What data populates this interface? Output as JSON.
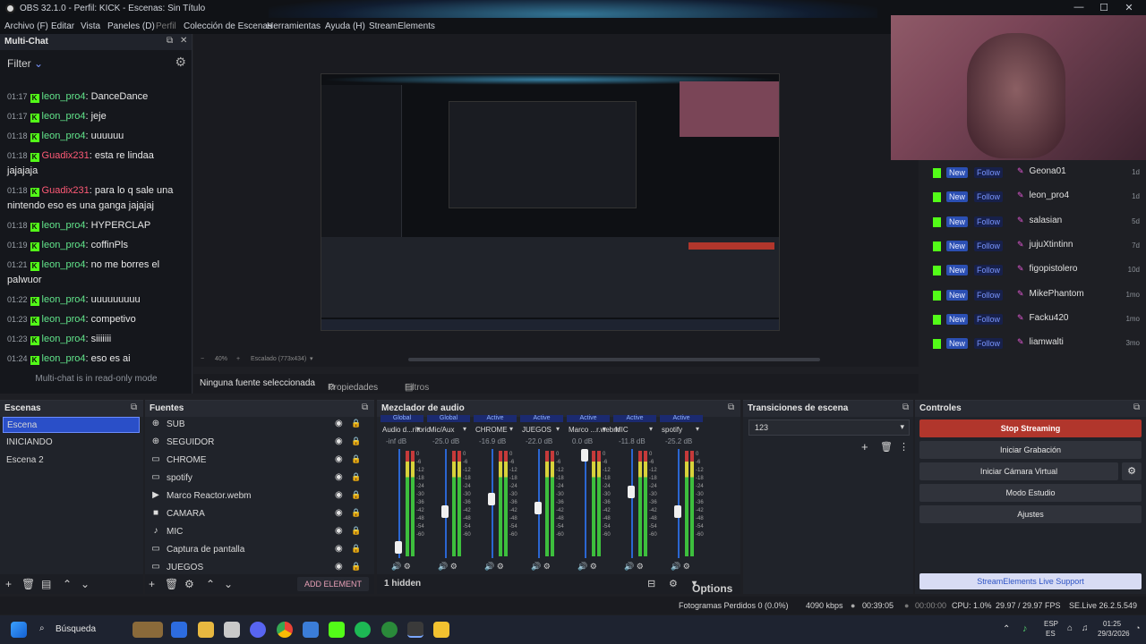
{
  "window": {
    "title": "OBS 32.1.0 - Perfil: KICK - Escenas: Sin Título",
    "controls": [
      "—",
      "☐",
      "✕"
    ]
  },
  "menu": [
    "Archivo (F)",
    "Editar",
    "Vista",
    "Paneles (D)",
    "Perfil",
    "Colección de Escenas",
    "Herramientas",
    "Ayuda (H)",
    "StreamElements"
  ],
  "multichat": {
    "title": "Multi-Chat",
    "filter": "Filter",
    "readonly": "Multi-chat is in read-only mode",
    "messages": [
      {
        "time": "01:17",
        "user": "leon_pro4",
        "text": "DanceDance",
        "c": "u1"
      },
      {
        "time": "01:17",
        "user": "leon_pro4",
        "text": "jeje",
        "c": "u1"
      },
      {
        "time": "01:18",
        "user": "leon_pro4",
        "text": "uuuuuu",
        "c": "u1"
      },
      {
        "time": "01:18",
        "user": "Guadix231",
        "text": "esta re lindaa jajajaja",
        "c": "u2"
      },
      {
        "time": "01:18",
        "user": "Guadix231",
        "text": "para lo q sale una nintendo eso es una ganga jajajaj",
        "c": "u2"
      },
      {
        "time": "01:18",
        "user": "leon_pro4",
        "text": "HYPERCLAP",
        "c": "u1"
      },
      {
        "time": "01:19",
        "user": "leon_pro4",
        "text": "coffinPls",
        "c": "u1"
      },
      {
        "time": "01:21",
        "user": "leon_pro4",
        "text": "no me borres el palwuor",
        "c": "u1"
      },
      {
        "time": "01:22",
        "user": "leon_pro4",
        "text": "uuuuuuuuu",
        "c": "u1"
      },
      {
        "time": "01:23",
        "user": "leon_pro4",
        "text": "competivo",
        "c": "u1"
      },
      {
        "time": "01:23",
        "user": "leon_pro4",
        "text": "siiiiiii",
        "c": "u1"
      },
      {
        "time": "01:24",
        "user": "leon_pro4",
        "text": "eso es ai",
        "c": "u1"
      }
    ]
  },
  "preview": {
    "zoom": "40%",
    "scale": "Escalado (773x434)"
  },
  "follows": [
    {
      "badge": "New",
      "btn": "Follow",
      "name": "Geona01",
      "time": "1d"
    },
    {
      "badge": "New",
      "btn": "Follow",
      "name": "leon_pro4",
      "time": "1d"
    },
    {
      "badge": "New",
      "btn": "Follow",
      "name": "salasian",
      "time": "5d"
    },
    {
      "badge": "New",
      "btn": "Follow",
      "name": "jujuXtintinn",
      "time": "7d"
    },
    {
      "badge": "New",
      "btn": "Follow",
      "name": "figopistolero",
      "time": "10d"
    },
    {
      "badge": "New",
      "btn": "Follow",
      "name": "MikePhantom",
      "time": "1mo"
    },
    {
      "badge": "New",
      "btn": "Follow",
      "name": "Facku420",
      "time": "1mo"
    },
    {
      "badge": "New",
      "btn": "Follow",
      "name": "liamwalti",
      "time": "3mo"
    }
  ],
  "source_bar": {
    "status": "Ninguna fuente seleccionada",
    "properties": "Propiedades",
    "filters": "Filtros"
  },
  "scenes": {
    "title": "Escenas",
    "items": [
      "Escena",
      "INICIANDO",
      "Escena 2"
    ],
    "selected": 0
  },
  "sources": {
    "title": "Fuentes",
    "add": "ADD ELEMENT",
    "items": [
      {
        "icon": "globe-icon",
        "glyph": "⊕",
        "name": "SUB"
      },
      {
        "icon": "globe-icon",
        "glyph": "⊕",
        "name": "SEGUIDOR"
      },
      {
        "icon": "window-icon",
        "glyph": "▭",
        "name": "CHROME"
      },
      {
        "icon": "window-icon",
        "glyph": "▭",
        "name": "spotify"
      },
      {
        "icon": "play-icon",
        "glyph": "▶",
        "name": "Marco Reactor.webm"
      },
      {
        "icon": "camera-icon",
        "glyph": "■",
        "name": "CAMARA"
      },
      {
        "icon": "mic-icon",
        "glyph": "♪",
        "name": "MIC"
      },
      {
        "icon": "display-icon",
        "glyph": "▭",
        "name": "Captura de pantalla"
      },
      {
        "icon": "window-icon",
        "glyph": "▭",
        "name": "JUEGOS"
      }
    ]
  },
  "mixer": {
    "title": "Mezclador de audio",
    "hidden": "1 hidden",
    "options": "Options",
    "scale_labels": [
      "0",
      "-6",
      "-12",
      "-18",
      "-24",
      "-30",
      "-36",
      "-42",
      "-48",
      "-54",
      "-60"
    ],
    "channels": [
      {
        "status": "Global",
        "name": "Audio d...ritorio",
        "db": "-inf dB",
        "level": 0.05
      },
      {
        "status": "Global",
        "name": "Mic/Aux",
        "db": "-25.0 dB",
        "level": 0.42
      },
      {
        "status": "Active",
        "name": "CHROME",
        "db": "-16.9 dB",
        "level": 0.55
      },
      {
        "status": "Active",
        "name": "JUEGOS",
        "db": "-22.0 dB",
        "level": 0.45
      },
      {
        "status": "Active",
        "name": "Marco ...r.webm",
        "db": "0.0 dB",
        "level": 1.0
      },
      {
        "status": "Active",
        "name": "MIC",
        "db": "-11.8 dB",
        "level": 0.62
      },
      {
        "status": "Active",
        "name": "spotify",
        "db": "-25.2 dB",
        "level": 0.42
      }
    ]
  },
  "transitions": {
    "title": "Transiciones de escena",
    "selected": "123"
  },
  "controls": {
    "title": "Controles",
    "stop_streaming": "Stop Streaming",
    "record": "Iniciar Grabación",
    "virtual_cam": "Iniciar Cámara Virtual",
    "studio": "Modo Estudio",
    "settings": "Ajustes",
    "se_support": "StreamElements Live Support"
  },
  "status": {
    "dropped": "Fotogramas Perdidos 0 (0.0%)",
    "kbps": "4090 kbps",
    "live_time": "00:39:05",
    "rec_time": "00:00:00",
    "cpu": "CPU: 1.0%",
    "fps": "29.97 / 29.97 FPS",
    "version": "SE.Live 26.2.5.549"
  },
  "taskbar": {
    "search": "Búsqueda",
    "lang": "ESP",
    "lang2": "ES",
    "time": "01:25",
    "date": "29/3/2026"
  }
}
